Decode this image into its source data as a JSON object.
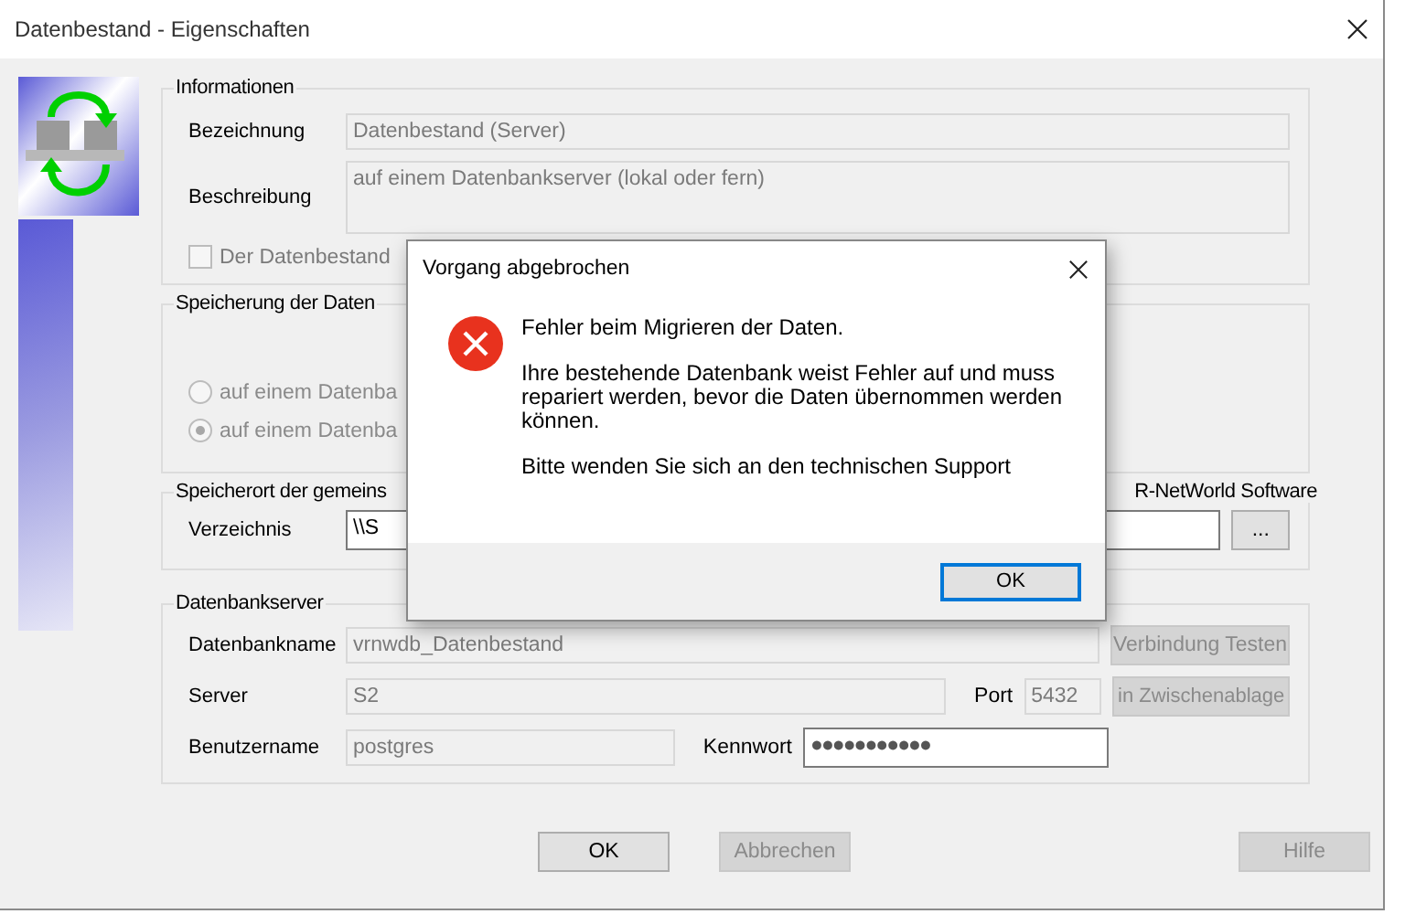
{
  "window": {
    "title": "Datenbestand - Eigenschaften"
  },
  "informationen": {
    "legend": "Informationen",
    "fields": [
      {
        "label": "Bezeichnung",
        "value": "Datenbestand (Server)",
        "multiline": false
      },
      {
        "label": "Beschreibung",
        "value": "auf einem Datenbankserver (lokal oder fern)",
        "multiline": true
      }
    ],
    "checkbox": {
      "label": "Der Datenbestand",
      "checked": false
    }
  },
  "speicherung": {
    "legend": "Speicherung der Daten",
    "options": [
      {
        "label": "auf einem Datenba",
        "selected": false
      },
      {
        "label": "auf einem Datenba",
        "selected": true
      }
    ]
  },
  "speicherort": {
    "legend": "Speicherort der gemeins",
    "legend_tail": "R-NetWorld Software",
    "label": "Verzeichnis",
    "value": "\\\\S",
    "browse": "..."
  },
  "datenbankserver": {
    "legend": "Datenbankserver",
    "database": {
      "label": "Datenbankname",
      "value": "vrnwdb_Datenbestand",
      "disabled": true
    },
    "server": {
      "label": "Server",
      "value": "S2",
      "disabled": true
    },
    "port": {
      "label": "Port",
      "value": "5432",
      "disabled": true
    },
    "user": {
      "label": "Benutzername",
      "value": "postgres",
      "disabled": true
    },
    "password": {
      "label": "Kennwort",
      "value": "●●●●●●●●●●●",
      "disabled": false
    },
    "test_button": {
      "label": "Verbindung Testen",
      "disabled": true
    },
    "clipboard_button": {
      "label": "in Zwischenablage",
      "disabled": true
    }
  },
  "buttons": [
    {
      "label": "OK",
      "disabled": false
    },
    {
      "label": "Abbrechen",
      "disabled": true
    },
    {
      "label": "Hilfe",
      "disabled": true
    }
  ],
  "dialog": {
    "title": "Vorgang abgebrochen",
    "messages": [
      "Fehler beim Migrieren der Daten.",
      "Ihre bestehende Datenbank weist Fehler auf und muss repariert werden, bevor die Daten übernommen werden können.",
      "Bitte wenden Sie sich an den technischen Support"
    ],
    "button": "OK"
  }
}
